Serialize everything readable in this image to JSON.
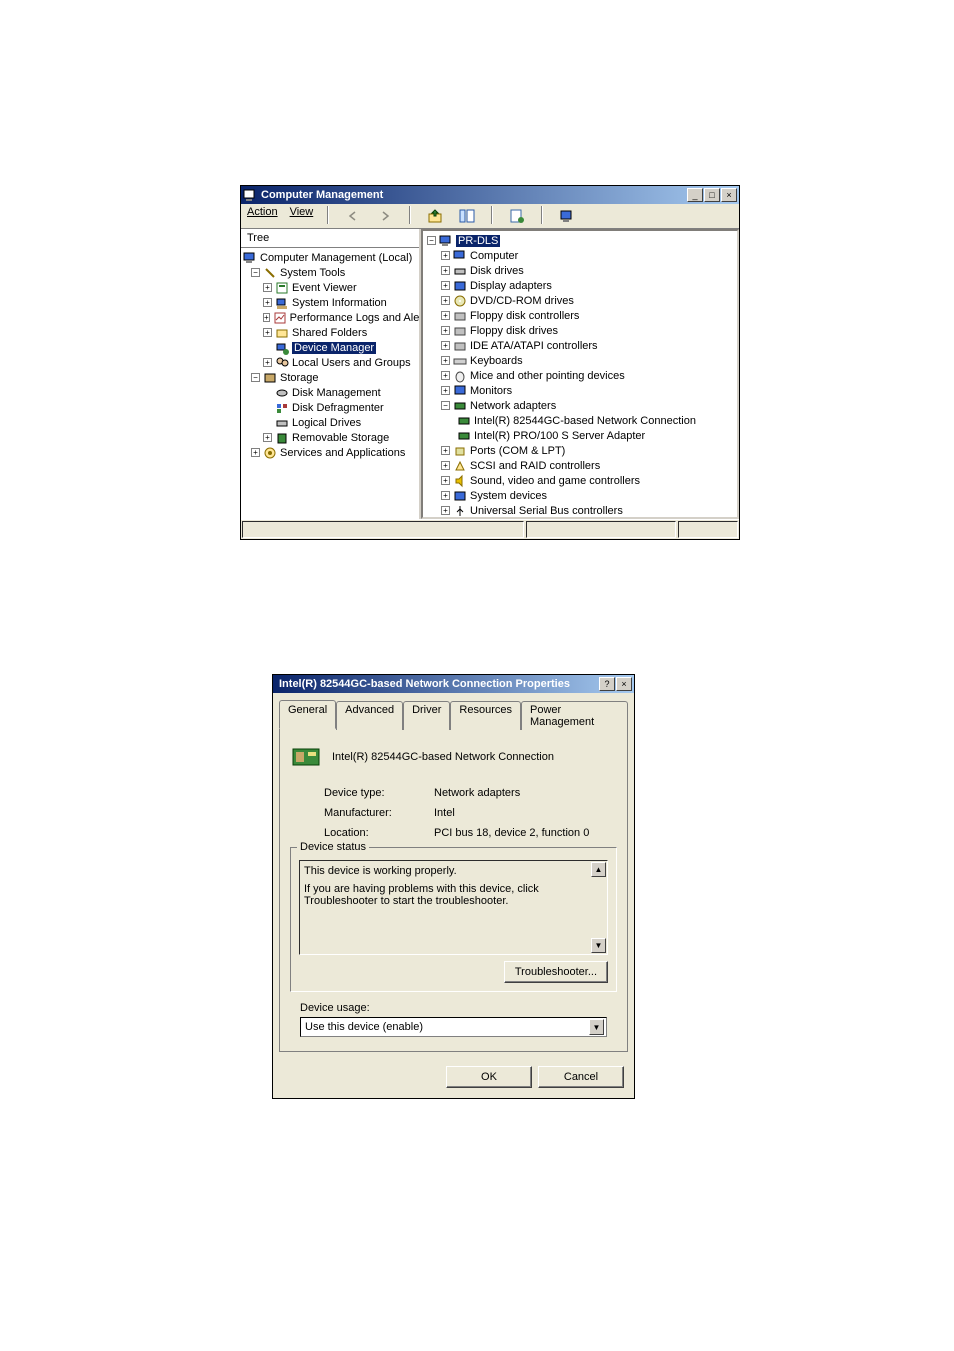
{
  "cm": {
    "title": "Computer Management",
    "menu": {
      "action": "Action",
      "view": "View"
    },
    "left_tab": "Tree",
    "left_tree": {
      "root": "Computer Management (Local)",
      "system_tools": "System Tools",
      "event_viewer": "Event Viewer",
      "system_information": "System Information",
      "perf_logs": "Performance Logs and Alerts",
      "shared_folders": "Shared Folders",
      "device_manager": "Device Manager",
      "local_users": "Local Users and Groups",
      "storage": "Storage",
      "disk_management": "Disk Management",
      "disk_defrag": "Disk Defragmenter",
      "logical_drives": "Logical Drives",
      "removable_storage": "Removable Storage",
      "services_apps": "Services and Applications"
    },
    "right_tree": {
      "root": "PR-DLS",
      "computer": "Computer",
      "disk_drives": "Disk drives",
      "display_adapters": "Display adapters",
      "dvd_cdrom": "DVD/CD-ROM drives",
      "floppy_ctrl": "Floppy disk controllers",
      "floppy_drives": "Floppy disk drives",
      "ide": "IDE ATA/ATAPI controllers",
      "keyboards": "Keyboards",
      "mice": "Mice and other pointing devices",
      "monitors": "Monitors",
      "network_adapters": "Network adapters",
      "net0": "Intel(R) 82544GC-based Network Connection",
      "net1": "Intel(R) PRO/100 S Server Adapter",
      "ports": "Ports (COM & LPT)",
      "scsi": "SCSI and RAID controllers",
      "sound": "Sound, video and game controllers",
      "system_devices": "System devices",
      "usb": "Universal Serial Bus controllers"
    }
  },
  "prop": {
    "title": "Intel(R) 82544GC-based Network Connection Properties",
    "tabs": {
      "general": "General",
      "advanced": "Advanced",
      "driver": "Driver",
      "resources": "Resources",
      "power": "Power Management"
    },
    "device_name": "Intel(R) 82544GC-based Network Connection",
    "device_type_label": "Device type:",
    "device_type_value": "Network adapters",
    "manufacturer_label": "Manufacturer:",
    "manufacturer_value": "Intel",
    "location_label": "Location:",
    "location_value": "PCI bus 18, device 2, function 0",
    "status_legend": "Device status",
    "status_line1": "This device is working properly.",
    "status_line2": "If you are having problems with this device, click Troubleshooter to start the troubleshooter.",
    "troubleshooter_btn": "Troubleshooter...",
    "usage_label": "Device usage:",
    "usage_value": "Use this device (enable)",
    "ok": "OK",
    "cancel": "Cancel"
  }
}
